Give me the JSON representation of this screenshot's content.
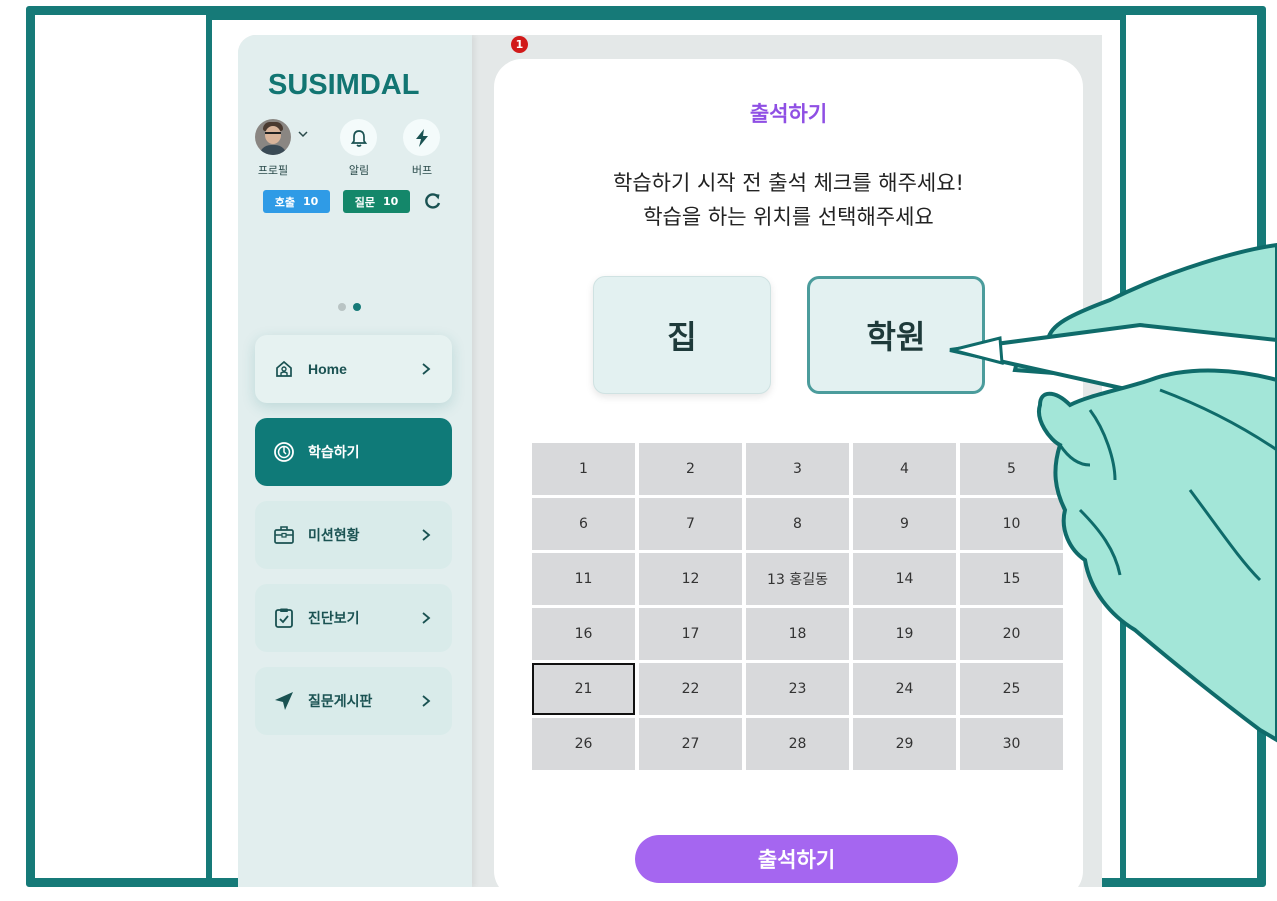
{
  "app": {
    "brand": "SUSIMDAL"
  },
  "header": {
    "profile_label": "프로필",
    "alarm_label": "알림",
    "buff_label": "버프",
    "call_badge": {
      "label": "호출",
      "count": "10",
      "color": "#2f9be6"
    },
    "question_badge": {
      "label": "질문",
      "count": "10",
      "color": "#14876a"
    }
  },
  "sidebar": {
    "items": [
      {
        "label": "Home",
        "icon": "home-icon",
        "active": false
      },
      {
        "label": "학습하기",
        "icon": "study-icon",
        "active": true
      },
      {
        "label": "미션현황",
        "icon": "briefcase-icon",
        "active": false
      },
      {
        "label": "진단보기",
        "icon": "clipboard-check-icon",
        "active": false
      },
      {
        "label": "질문게시판",
        "icon": "send-icon",
        "active": false
      }
    ]
  },
  "notification": {
    "count": "1"
  },
  "main": {
    "title": "출석하기",
    "instruction_line1": "학습하기 시작 전 출석 체크를 해주세요!",
    "instruction_line2": "학습을 하는 위치를 선택해주세요",
    "location_home": "집",
    "location_academy": "학원",
    "seats": [
      "1",
      "2",
      "3",
      "4",
      "5",
      "6",
      "7",
      "8",
      "9",
      "10",
      "11",
      "12",
      "13 홍길동",
      "14",
      "15",
      "16",
      "17",
      "18",
      "19",
      "20",
      "21",
      "22",
      "23",
      "24",
      "25",
      "26",
      "27",
      "28",
      "29",
      "30"
    ],
    "selected_seat": "21",
    "submit_label": "출석하기"
  },
  "colors": {
    "accent": "#167a78",
    "purple": "#a566f0",
    "title_purple": "#8f4fe4",
    "frame": "#167a78",
    "hand_fill": "#a3e6d8"
  }
}
